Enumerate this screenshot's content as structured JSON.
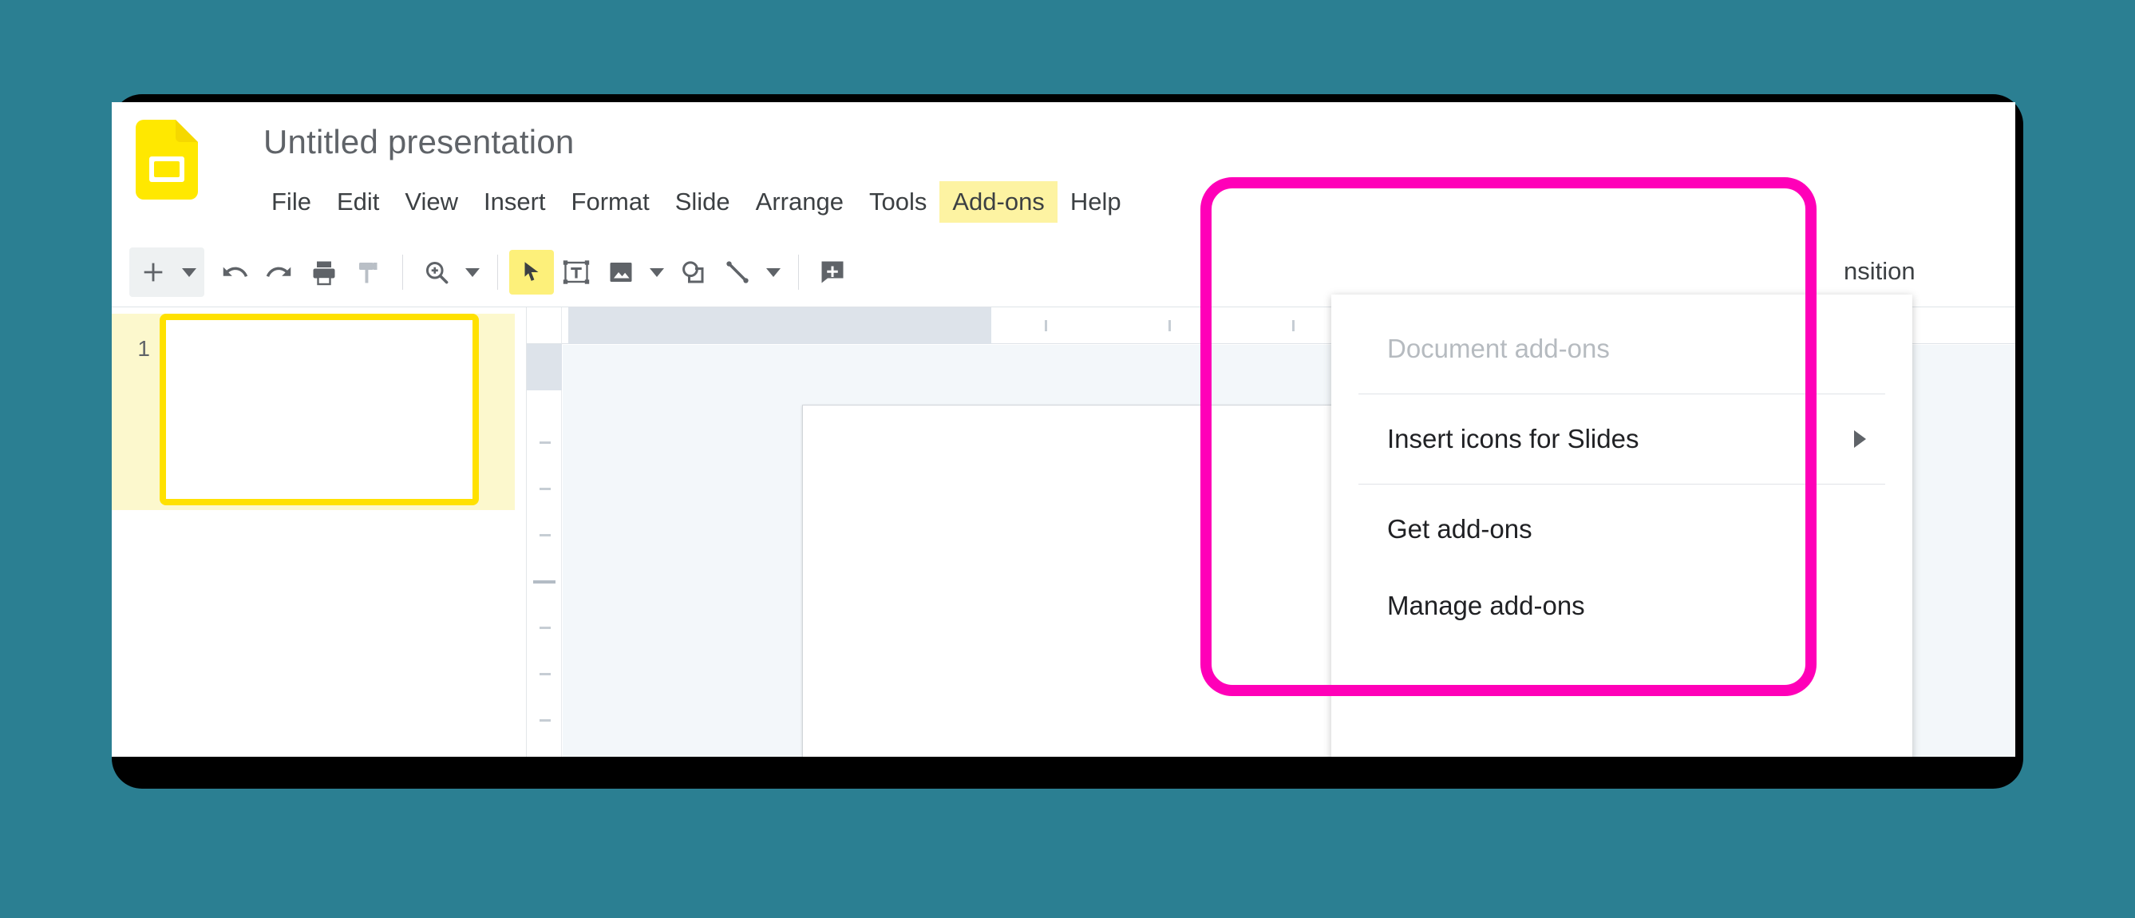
{
  "page": {
    "background_color": "#2b7f92",
    "frame_color": "#000000",
    "annotation_color": "#ff00b8",
    "highlight_color": "#fdf3a2"
  },
  "titlebar": {
    "logo_icon": "google-slides-icon",
    "document_title": "Untitled presentation"
  },
  "menubar": {
    "items": [
      {
        "label": "File",
        "highlighted": false
      },
      {
        "label": "Edit",
        "highlighted": false
      },
      {
        "label": "View",
        "highlighted": false
      },
      {
        "label": "Insert",
        "highlighted": false
      },
      {
        "label": "Format",
        "highlighted": false
      },
      {
        "label": "Slide",
        "highlighted": false
      },
      {
        "label": "Arrange",
        "highlighted": false
      },
      {
        "label": "Tools",
        "highlighted": false
      },
      {
        "label": "Add-ons",
        "highlighted": true
      },
      {
        "label": "Help",
        "highlighted": false
      }
    ]
  },
  "toolbar": {
    "new_slide_icon": "plus-icon",
    "new_slide_caret_icon": "chevron-down-icon",
    "undo_icon": "undo-icon",
    "redo_icon": "redo-icon",
    "print_icon": "print-icon",
    "paint_format_icon": "paint-format-icon",
    "zoom_icon": "zoom-in-icon",
    "zoom_caret_icon": "chevron-down-icon",
    "select_icon": "cursor-arrow-icon",
    "textbox_icon": "text-box-icon",
    "image_icon": "image-icon",
    "image_caret_icon": "chevron-down-icon",
    "shape_icon": "shape-icon",
    "line_icon": "line-icon",
    "line_caret_icon": "chevron-down-icon",
    "comment_icon": "add-comment-icon",
    "transition_label": "nsition"
  },
  "filmstrip": {
    "slide_number": "1",
    "slide_selected": true
  },
  "addons_dropdown": {
    "open": true,
    "items": [
      {
        "label": "Document add-ons",
        "disabled": true,
        "has_submenu": false
      },
      {
        "label": "Insert icons for Slides",
        "disabled": false,
        "has_submenu": true,
        "submenu_icon": "submenu-arrow-icon"
      },
      {
        "label": "Get add-ons",
        "disabled": false,
        "has_submenu": false
      },
      {
        "label": "Manage add-ons",
        "disabled": false,
        "has_submenu": false
      }
    ]
  }
}
